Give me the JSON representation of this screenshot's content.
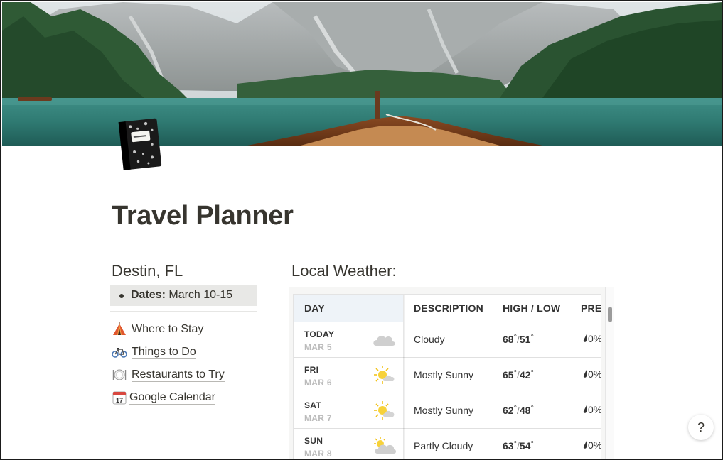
{
  "page": {
    "title": "Travel Planner"
  },
  "trip": {
    "city": "Destin, FL",
    "dates_label": "Dates:",
    "dates_value": "March 10-15"
  },
  "links": [
    {
      "icon": "camping-tent-icon",
      "label": "Where to Stay"
    },
    {
      "icon": "bicycle-icon",
      "label": "Things to Do"
    },
    {
      "icon": "plate-cutlery-icon",
      "label": "Restaurants to Try"
    },
    {
      "icon": "calendar-icon",
      "label": "Google Calendar",
      "calendar_day": "17"
    }
  ],
  "weather": {
    "title": "Local Weather:",
    "columns": [
      "DAY",
      "DESCRIPTION",
      "HIGH / LOW",
      "PRE"
    ],
    "rows": [
      {
        "day": "TODAY",
        "date": "MAR 5",
        "icon": "cloudy-icon",
        "description": "Cloudy",
        "high": "68",
        "low": "51",
        "precip": "0%"
      },
      {
        "day": "FRI",
        "date": "MAR 6",
        "icon": "mostly-sunny-icon",
        "description": "Mostly Sunny",
        "high": "65",
        "low": "42",
        "precip": "0%"
      },
      {
        "day": "SAT",
        "date": "MAR 7",
        "icon": "mostly-sunny-icon",
        "description": "Mostly Sunny",
        "high": "62",
        "low": "48",
        "precip": "0%"
      },
      {
        "day": "SUN",
        "date": "MAR 8",
        "icon": "partly-cloudy-icon",
        "description": "Partly Cloudy",
        "high": "63",
        "low": "54",
        "precip": "0%"
      }
    ]
  },
  "help": {
    "label": "?"
  },
  "colors": {
    "text": "#37352f",
    "highlight_bg": "#e8e8e6",
    "weather_header_bg": "#eef3f8",
    "lake": "#2f7a72"
  }
}
